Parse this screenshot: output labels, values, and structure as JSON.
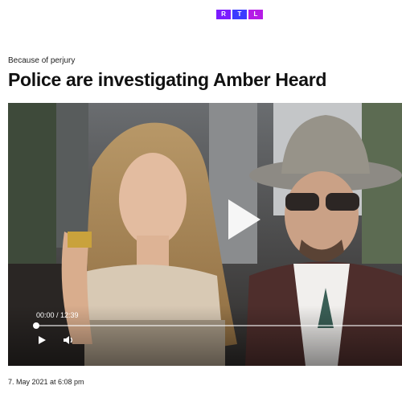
{
  "brand": {
    "letters": [
      "R",
      "T",
      "L"
    ],
    "colors": [
      "#7b1cff",
      "#3b3bff",
      "#b51ce6"
    ]
  },
  "article": {
    "kicker": "Because of perjury",
    "headline": "Police are investigating Amber Heard",
    "date": "7. May 2021 at 6:08 pm"
  },
  "video": {
    "time_display": "00:00 / 12:39",
    "progress": 0,
    "controls": {
      "play_icon": "play-icon",
      "volume_icon": "volume-icon",
      "big_play_icon": "big-play-icon"
    }
  }
}
